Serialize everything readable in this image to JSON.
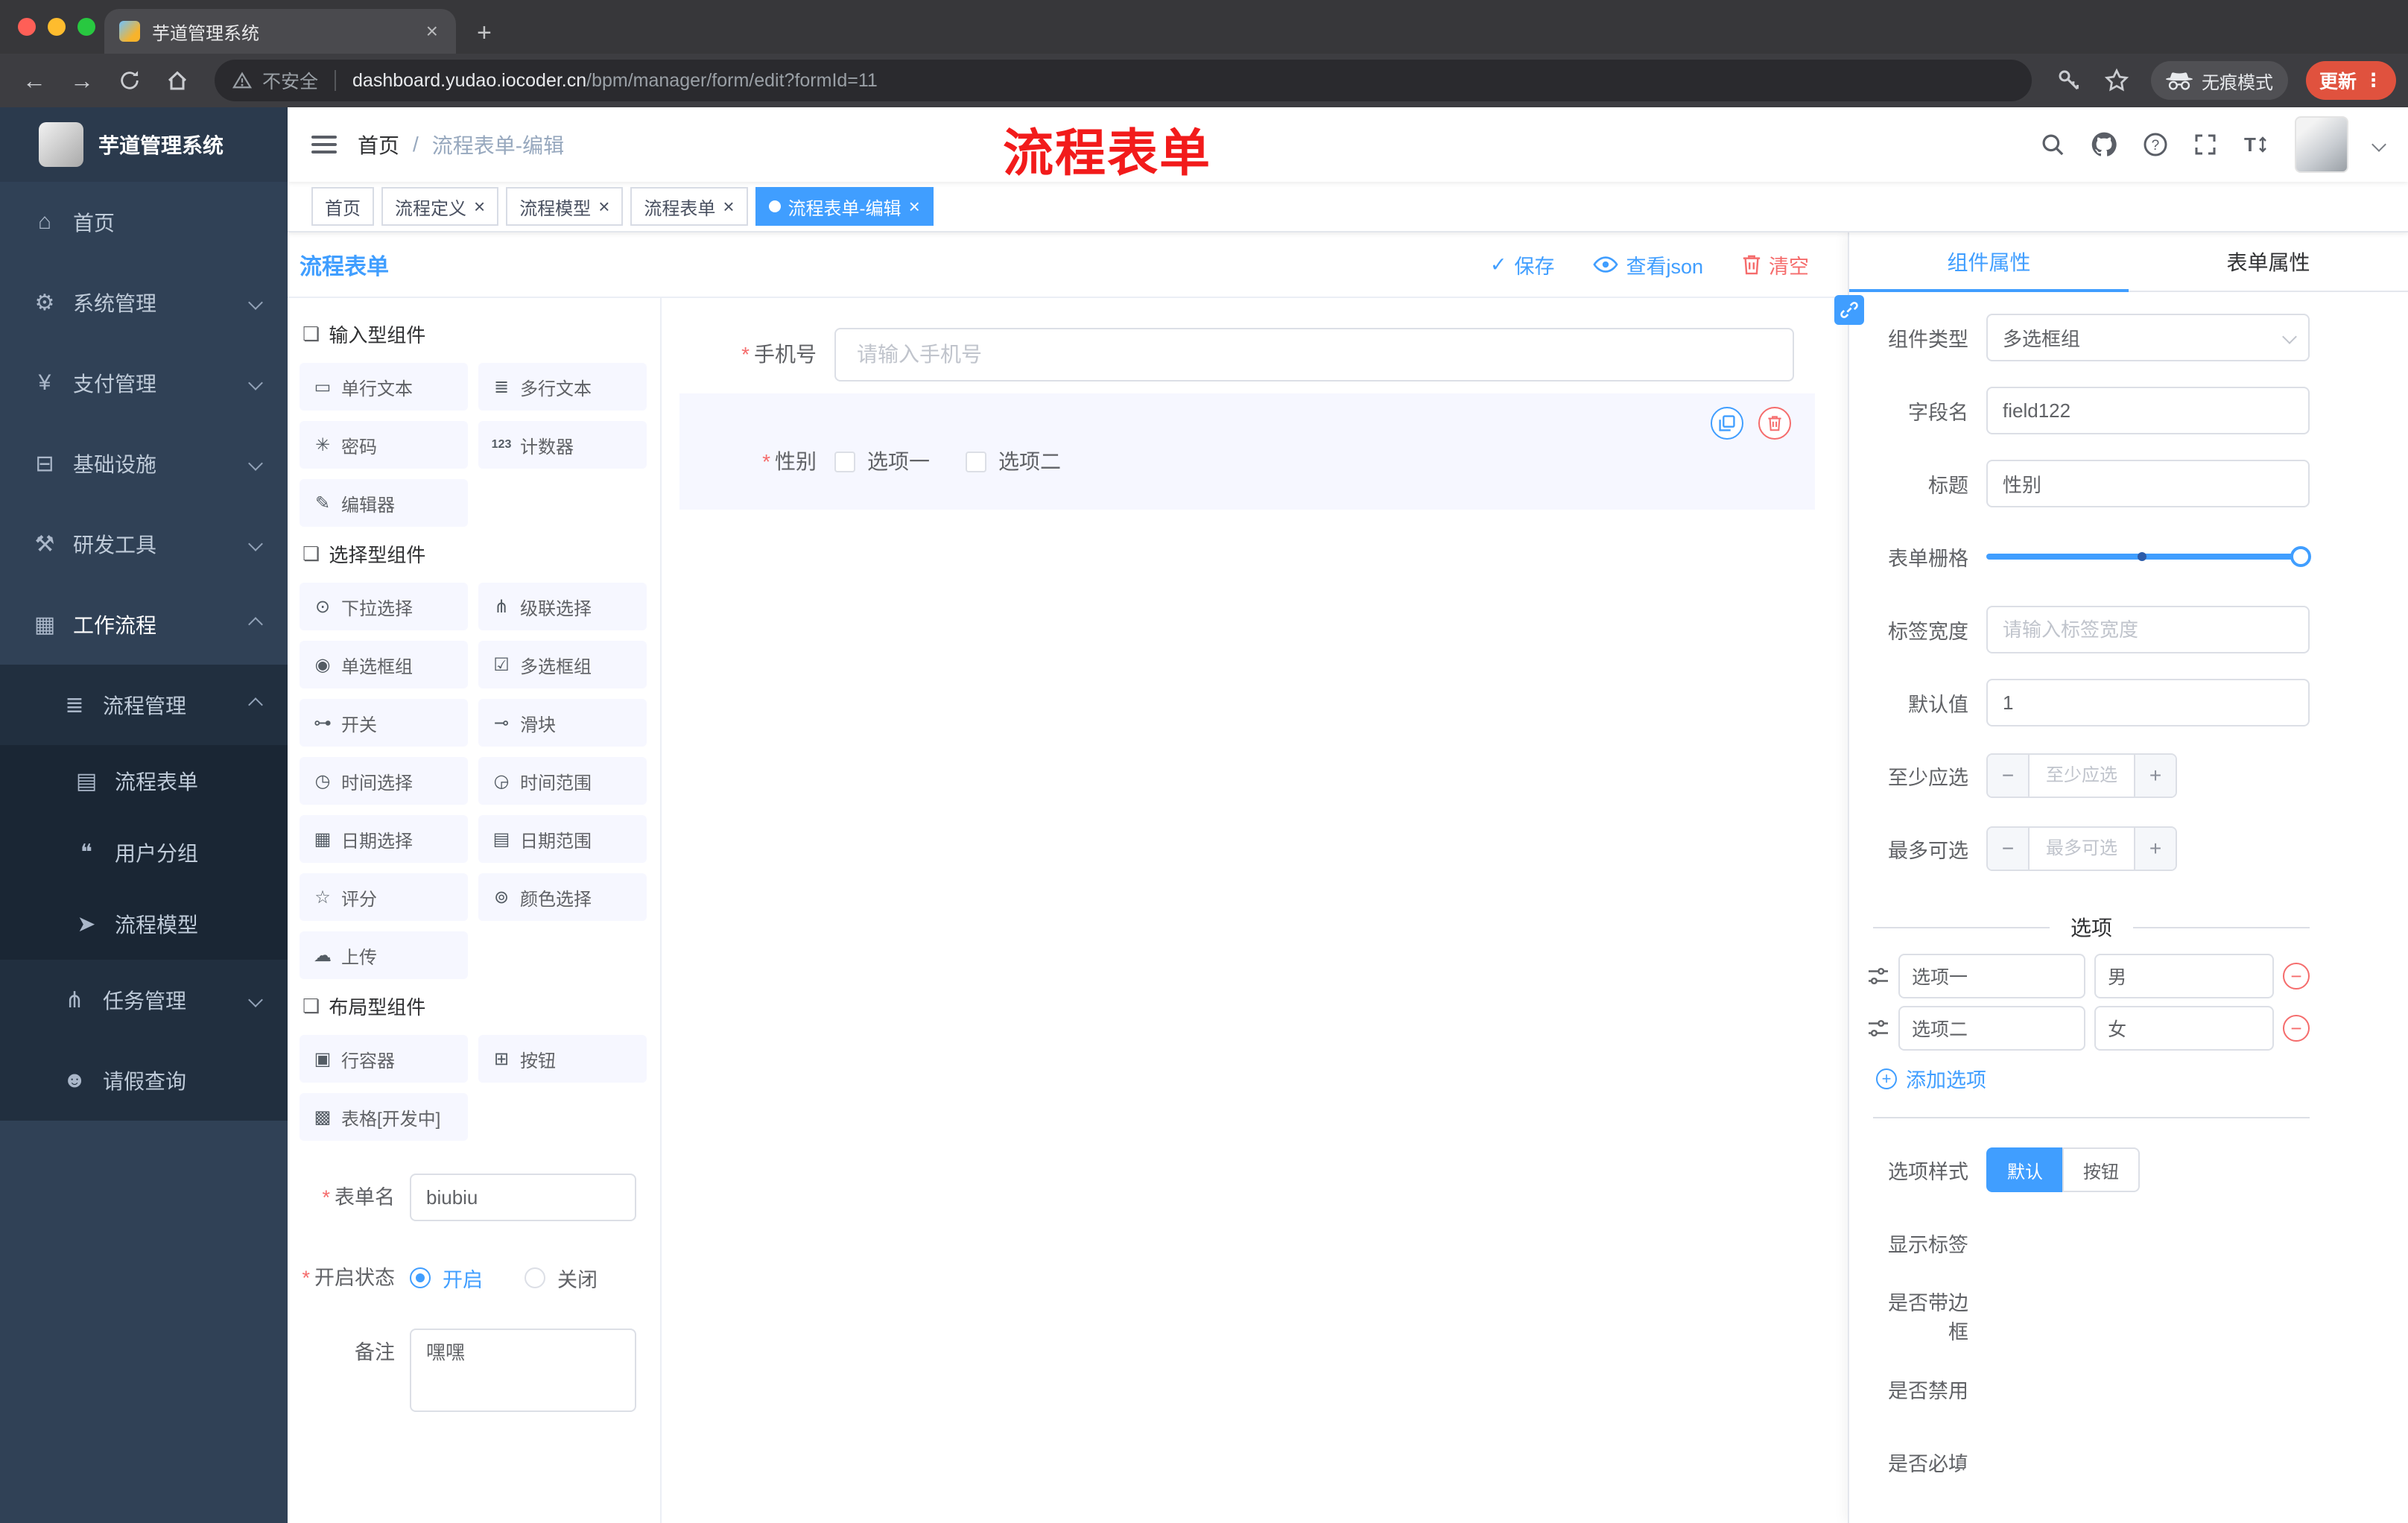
{
  "colors": {
    "accent": "#409eff",
    "danger": "#f56c6c",
    "annotation_red": "#f21b1b",
    "sidebar_bg": "#304156",
    "sidebar_submenu_bg": "#1f2d3d",
    "update_button_bg": "#e0523e",
    "traffic_red": "#ff5f57",
    "traffic_yellow": "#febc2e",
    "traffic_green": "#28c840",
    "palette_item_bg": "#f6f7ff"
  },
  "icons": {
    "section": "❏",
    "check": "✓",
    "close": "×",
    "plus": "+",
    "minus": "−",
    "dots": "⋮",
    "back": "←",
    "forward": "→"
  },
  "browser": {
    "tab_title": "芋道管理系统",
    "security": "不安全",
    "domain": "dashboard.yudao.iocoder.cn",
    "path": "/bpm/manager/form/edit?formId=11",
    "incognito": "无痕模式",
    "update": "更新"
  },
  "header": {
    "breadcrumb_root": "首页",
    "breadcrumb_sep": "/",
    "breadcrumb_current": "流程表单-编辑",
    "annotation": "流程表单"
  },
  "tags": [
    {
      "label": "首页",
      "active": false,
      "closable": false
    },
    {
      "label": "流程定义",
      "active": false,
      "closable": true
    },
    {
      "label": "流程模型",
      "active": false,
      "closable": true
    },
    {
      "label": "流程表单",
      "active": false,
      "closable": true
    },
    {
      "label": "流程表单-编辑",
      "active": true,
      "closable": true
    }
  ],
  "sidebar": {
    "logo": "芋道管理系统",
    "menu": [
      {
        "label": "首页",
        "glyph": "⌂"
      },
      {
        "label": "系统管理",
        "glyph": "⚙"
      },
      {
        "label": "支付管理",
        "glyph": "¥"
      },
      {
        "label": "基础设施",
        "glyph": "⊟"
      },
      {
        "label": "研发工具",
        "glyph": "⚒"
      },
      {
        "label": "工作流程",
        "glyph": "▦"
      },
      {
        "label": "流程管理",
        "glyph": "≣"
      },
      {
        "label": "流程表单",
        "glyph": "▤"
      },
      {
        "label": "用户分组",
        "glyph": "❝"
      },
      {
        "label": "流程模型",
        "glyph": "➤"
      },
      {
        "label": "任务管理",
        "glyph": "⋔"
      },
      {
        "label": "请假查询",
        "glyph": "☻"
      }
    ]
  },
  "designer": {
    "title": "流程表单",
    "actions": {
      "save": "保存",
      "view_json": "查看json",
      "clear": "清空"
    },
    "palette": {
      "sections": [
        {
          "title": "输入型组件",
          "items": [
            {
              "label": "单行文本",
              "glyph": "▭"
            },
            {
              "label": "多行文本",
              "glyph": "≣"
            },
            {
              "label": "密码",
              "glyph": "✳"
            },
            {
              "label": "计数器",
              "glyph": "123"
            },
            {
              "label": "编辑器",
              "glyph": "✎"
            }
          ]
        },
        {
          "title": "选择型组件",
          "items": [
            {
              "label": "下拉选择",
              "glyph": "⊙"
            },
            {
              "label": "级联选择",
              "glyph": "⋔"
            },
            {
              "label": "单选框组",
              "glyph": "◉"
            },
            {
              "label": "多选框组",
              "glyph": "☑"
            },
            {
              "label": "开关",
              "glyph": "⊶"
            },
            {
              "label": "滑块",
              "glyph": "⊸"
            },
            {
              "label": "时间选择",
              "glyph": "◷"
            },
            {
              "label": "时间范围",
              "glyph": "◶"
            },
            {
              "label": "日期选择",
              "glyph": "▦"
            },
            {
              "label": "日期范围",
              "glyph": "▤"
            },
            {
              "label": "评分",
              "glyph": "☆"
            },
            {
              "label": "颜色选择",
              "glyph": "⊚"
            },
            {
              "label": "上传",
              "glyph": "☁"
            }
          ]
        },
        {
          "title": "布局型组件",
          "items": [
            {
              "label": "行容器",
              "glyph": "▣"
            },
            {
              "label": "按钮",
              "glyph": "⊞"
            },
            {
              "label": "表格[开发中]",
              "glyph": "▩"
            }
          ]
        }
      ]
    },
    "left_form": {
      "name_label": "表单名",
      "name_value": "biubiu",
      "status_label": "开启状态",
      "status_on": "开启",
      "status_off": "关闭",
      "remark_label": "备注",
      "remark_value": "嘿嘿"
    },
    "canvas": {
      "phone": {
        "label": "手机号",
        "placeholder": "请输入手机号"
      },
      "gender": {
        "label": "性别",
        "options": [
          "选项一",
          "选项二"
        ]
      }
    },
    "props": {
      "tab_component": "组件属性",
      "tab_form": "表单属性",
      "component_type_label": "组件类型",
      "component_type_value": "多选框组",
      "field_label": "字段名",
      "field_value": "field122",
      "title_label": "标题",
      "title_value": "性别",
      "grid_label": "表单栅格",
      "label_width_label": "标签宽度",
      "label_width_placeholder": "请输入标签宽度",
      "default_label": "默认值",
      "default_value": "1",
      "min_label": "至少应选",
      "min_placeholder": "至少应选",
      "max_label": "最多可选",
      "max_placeholder": "最多可选",
      "options_title": "选项",
      "options": [
        {
          "label": "选项一",
          "value": "男"
        },
        {
          "label": "选项二",
          "value": "女"
        }
      ],
      "add_option": "添加选项",
      "style_label": "选项样式",
      "style_default": "默认",
      "style_button": "按钮",
      "switch_show_label": "显示标签",
      "switch_border": "是否带边框",
      "switch_disabled": "是否禁用",
      "switch_required": "是否必填"
    }
  }
}
